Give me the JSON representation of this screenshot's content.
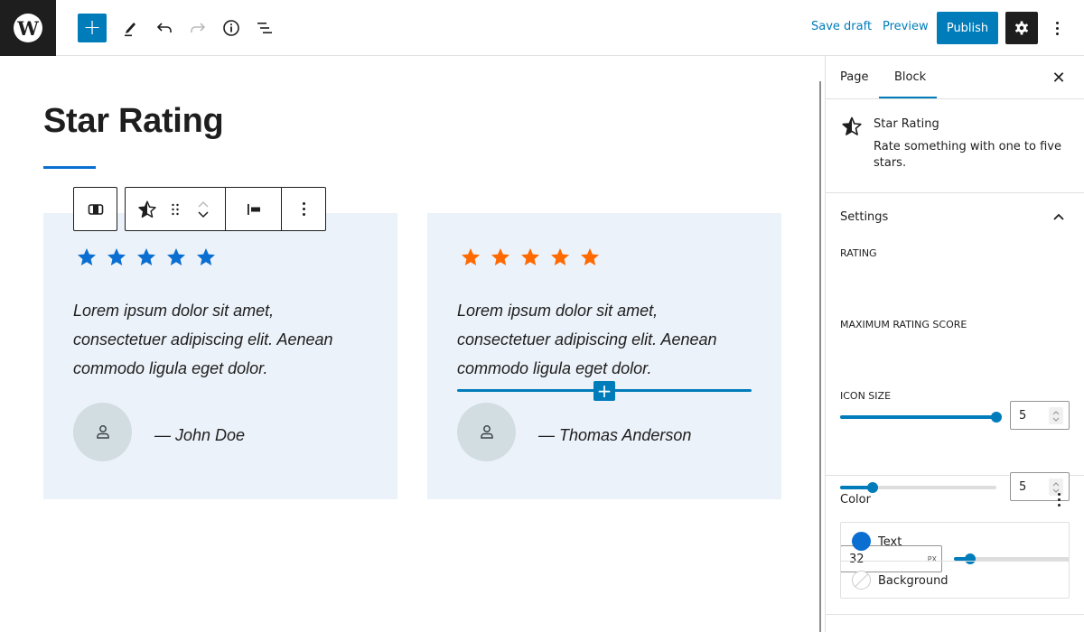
{
  "topbar": {
    "logo": "W",
    "add_block_label": "+",
    "icons": [
      "wordpress-logo-icon",
      "plus-icon",
      "pencil-icon",
      "undo-icon",
      "redo-icon",
      "info-icon",
      "list-view-icon",
      "gear-icon",
      "more-vertical-icon"
    ],
    "save_draft": "Save draft",
    "preview": "Preview",
    "publish": "Publish"
  },
  "editor": {
    "page_title": "Star Rating",
    "accent_color": "#0a6fd1",
    "cards": [
      {
        "stars": 5,
        "star_color": "#0a6fd1",
        "quote": "Lorem ipsum dolor sit amet, consectetuer adipiscing elit. Aenean commodo ligula eget dolor.",
        "author": "— John Doe"
      },
      {
        "stars": 5,
        "star_color": "#ff6a00",
        "quote": "Lorem ipsum dolor sit amet, consectetuer adipiscing elit. Aenean commodo ligula eget dolor.",
        "author": "— Thomas Anderson"
      }
    ],
    "inserter_label": "+"
  },
  "sidebar": {
    "tabs": [
      {
        "label": "Page",
        "active": false
      },
      {
        "label": "Block",
        "active": true
      }
    ],
    "close_label": "✕",
    "block_card": {
      "name": "Star Rating",
      "description": "Rate something with one to five stars."
    },
    "settings": {
      "title": "Settings",
      "rating": {
        "label": "RATING",
        "value": "5",
        "fraction": 1.0
      },
      "max_rating": {
        "label": "MAXIMUM RATING SCORE",
        "value": "5",
        "fraction": 0.21
      },
      "icon_size": {
        "label": "ICON SIZE",
        "value": "32",
        "unit": "PX",
        "fraction": 0.14
      }
    },
    "color": {
      "title": "Color",
      "items": [
        {
          "label": "Text",
          "color": "#0a6fd1"
        },
        {
          "label": "Background",
          "color": "none"
        }
      ]
    }
  }
}
